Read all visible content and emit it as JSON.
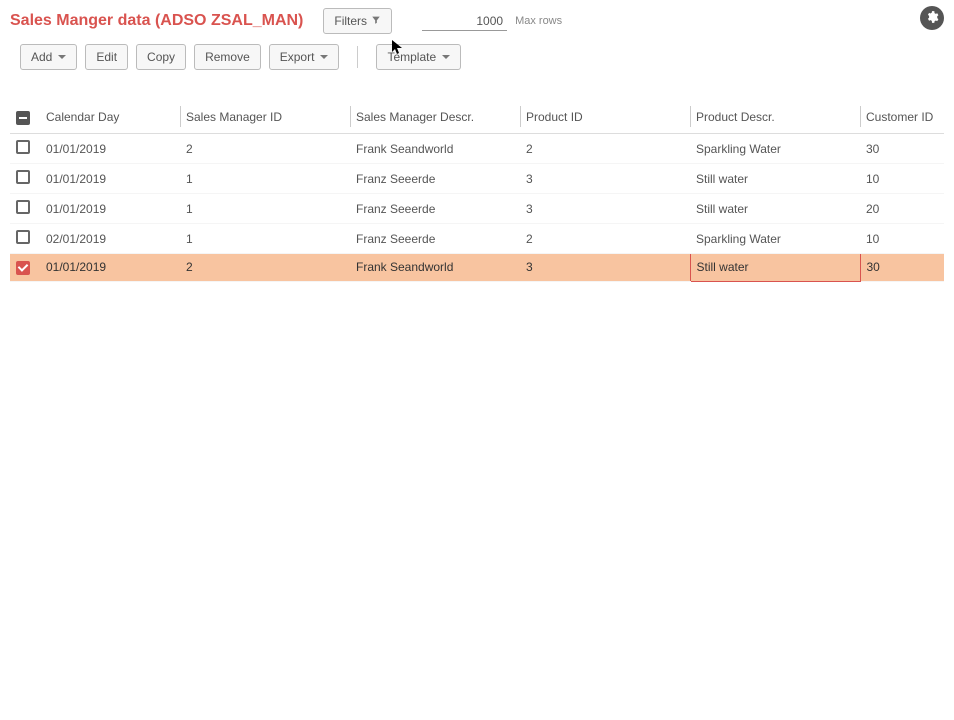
{
  "header": {
    "title": "Sales Manger data (ADSO ZSAL_MAN)",
    "filters_label": "Filters",
    "maxrows_value": "1000",
    "maxrows_label": "Max rows"
  },
  "toolbar": {
    "add_label": "Add",
    "edit_label": "Edit",
    "copy_label": "Copy",
    "remove_label": "Remove",
    "export_label": "Export",
    "template_label": "Template"
  },
  "table": {
    "columns": [
      "Calendar Day",
      "Sales Manager ID",
      "Sales Manager Descr.",
      "Product ID",
      "Product Descr.",
      "Customer ID"
    ],
    "rows": [
      {
        "checked": false,
        "selected": false,
        "cells": [
          "01/01/2019",
          "2",
          "Frank Seandworld",
          "2",
          "Sparkling Water",
          "30"
        ]
      },
      {
        "checked": false,
        "selected": false,
        "cells": [
          "01/01/2019",
          "1",
          "Franz Seeerde",
          "3",
          "Still water",
          "10"
        ]
      },
      {
        "checked": false,
        "selected": false,
        "cells": [
          "01/01/2019",
          "1",
          "Franz Seeerde",
          "3",
          "Still water",
          "20"
        ]
      },
      {
        "checked": false,
        "selected": false,
        "cells": [
          "02/01/2019",
          "1",
          "Franz Seeerde",
          "2",
          "Sparkling Water",
          "10"
        ]
      },
      {
        "checked": true,
        "selected": true,
        "cells": [
          "01/01/2019",
          "2",
          "Frank Seandworld",
          "3",
          "Still water",
          "30"
        ]
      }
    ]
  }
}
